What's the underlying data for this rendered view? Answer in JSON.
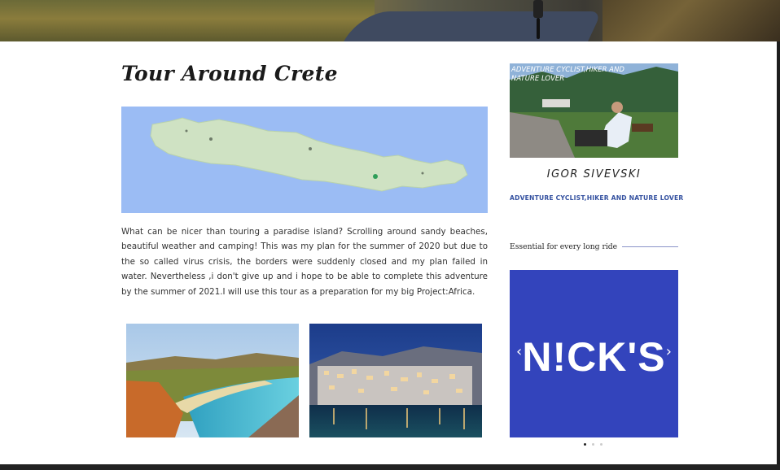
{
  "article": {
    "title": "Tour Around Crete",
    "body": "What can be nicer than touring a paradise island? Scrolling around sandy beaches, beautiful weather and camping! This was my plan for the summer of 2020 but due to the so called virus crisis, the borders were suddenly closed and my plan failed in water. Nevertheless ,i don't give up and  i hope to be able to complete this adventure by the summer of 2021.I will  use this tour as a preparation for my big Project:Africa."
  },
  "sidebar": {
    "profile_caption": "ADVENTURE CYCLIST,HIKER AND NATURE LOVER",
    "author_name": "IGOR SIVEVSKI",
    "tagline": "ADVENTURE CYCLIST,HIKER AND NATURE LOVER",
    "widget_title": "Essential for every long ride",
    "slider": {
      "brand": "N!CK'S",
      "prev_icon": "chevron-left-icon",
      "next_icon": "chevron-right-icon",
      "prev_glyph": "‹",
      "next_glyph": "›",
      "slide_count": 3,
      "active_slide": 1
    }
  },
  "colors": {
    "brand_blue": "#3344bc",
    "tagline_blue": "#3451a0",
    "map_water": "#9bbcf4",
    "map_land": "#cfe2c3"
  }
}
